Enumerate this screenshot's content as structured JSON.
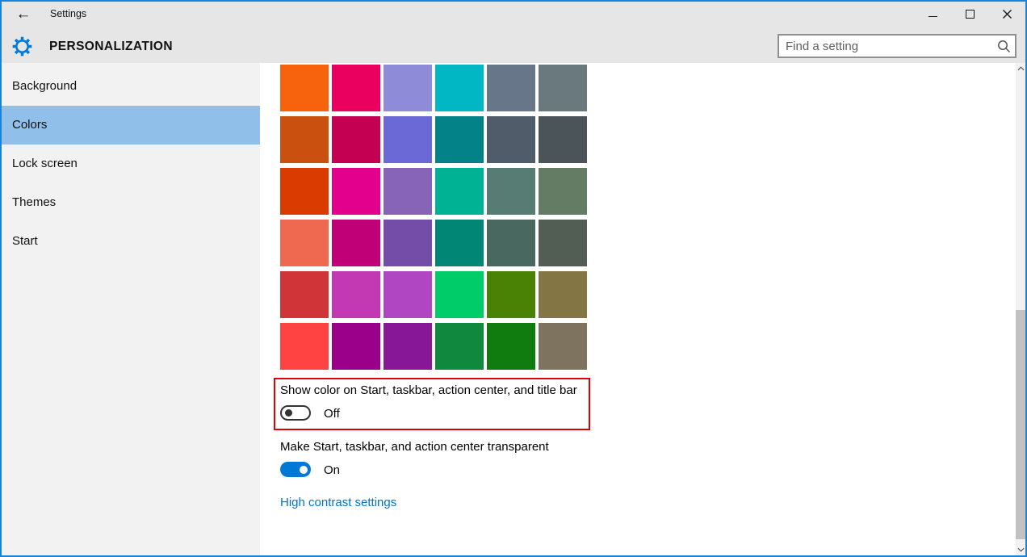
{
  "window": {
    "title": "Settings",
    "border_color": "#1884d9",
    "controls": {
      "minimize": "minimize",
      "maximize": "maximize",
      "close": "close"
    }
  },
  "header": {
    "page_title": "PERSONALIZATION",
    "accent_color": "#0078d7",
    "search": {
      "placeholder": "Find a setting"
    }
  },
  "sidebar": {
    "selected_bg": "#90c0e9",
    "items": [
      {
        "label": "Background",
        "selected": false
      },
      {
        "label": "Colors",
        "selected": true
      },
      {
        "label": "Lock screen",
        "selected": false
      },
      {
        "label": "Themes",
        "selected": false
      },
      {
        "label": "Start",
        "selected": false
      }
    ]
  },
  "content": {
    "color_grid": {
      "rows": 6,
      "cols": 6,
      "colors": [
        [
          "#f7630c",
          "#ea005e",
          "#8e8cd8",
          "#00b7c3",
          "#68768a",
          "#69797e"
        ],
        [
          "#ca5010",
          "#c30052",
          "#6b69d6",
          "#038387",
          "#515c6b",
          "#4a5459"
        ],
        [
          "#da3b01",
          "#e3008c",
          "#8764b8",
          "#00b294",
          "#567c73",
          "#647c64"
        ],
        [
          "#ef6950",
          "#bf0077",
          "#744da9",
          "#018574",
          "#486860",
          "#525e54"
        ],
        [
          "#d13438",
          "#c239b3",
          "#b146c2",
          "#00cc6a",
          "#498205",
          "#847545"
        ],
        [
          "#ff4343",
          "#9a0089",
          "#881798",
          "#10893e",
          "#107c10",
          "#7e735f"
        ]
      ]
    },
    "show_color_toggle": {
      "label": "Show color on Start, taskbar, action center, and title bar",
      "state": "Off",
      "highlighted": true,
      "highlight_color": "#e00000"
    },
    "transparency_toggle": {
      "label": "Make Start, taskbar, and action center transparent",
      "state": "On"
    },
    "high_contrast_link": {
      "label": "High contrast settings",
      "color": "#0073d1"
    }
  }
}
